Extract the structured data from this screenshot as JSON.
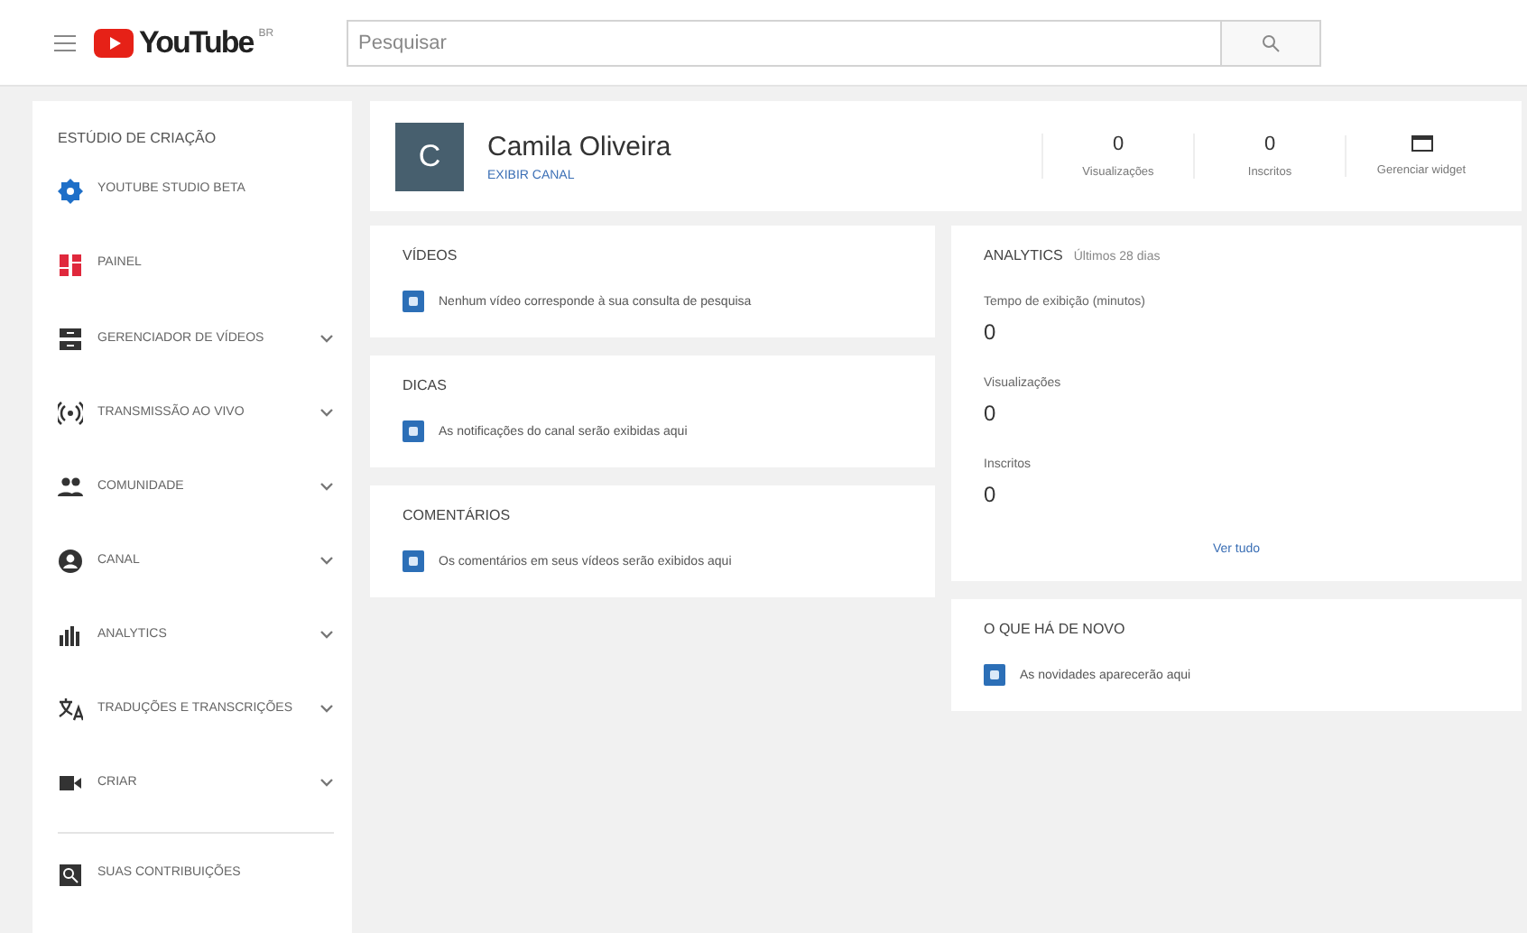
{
  "topbar": {
    "logo": "YouTube",
    "region": "BR",
    "search": {
      "placeholder": "Pesquisar"
    }
  },
  "sidebar": {
    "title": "ESTÚDIO DE CRIAÇÃO",
    "items": [
      {
        "label": "YOUTUBE STUDIO BETA",
        "kind": "gear",
        "color": "#1e6fc8",
        "expandable": false
      },
      {
        "label": "PAINEL",
        "kind": "dashboard",
        "color": "#e0283c",
        "expandable": false
      },
      {
        "label": "GERENCIADOR DE VÍDEOS",
        "kind": "videos",
        "color": "#333333",
        "expandable": true
      },
      {
        "label": "TRANSMISSÃO AO VIVO",
        "kind": "live",
        "color": "#333333",
        "expandable": true
      },
      {
        "label": "COMUNIDADE",
        "kind": "people",
        "color": "#333333",
        "expandable": true
      },
      {
        "label": "CANAL",
        "kind": "account",
        "color": "#333333",
        "expandable": true
      },
      {
        "label": "ANALYTICS",
        "kind": "bars",
        "color": "#333333",
        "expandable": true
      },
      {
        "label": "TRADUÇÕES E TRANSCRIÇÕES",
        "kind": "translate",
        "color": "#333333",
        "expandable": true
      },
      {
        "label": "CRIAR",
        "kind": "camera",
        "color": "#333333",
        "expandable": true
      }
    ],
    "footer": {
      "label": "SUAS CONTRIBUIÇÕES"
    }
  },
  "channel": {
    "initial": "C",
    "name": "Camila Oliveira",
    "link": "EXIBIR CANAL",
    "stats": [
      {
        "value": "0",
        "label": "Visualizações"
      },
      {
        "value": "0",
        "label": "Inscritos"
      }
    ],
    "widget": "Gerenciar widget"
  },
  "cards": [
    {
      "title": "VÍDEOS",
      "message": "Nenhum vídeo corresponde à sua consulta de pesquisa"
    },
    {
      "title": "DICAS",
      "message": "As notificações do canal serão exibidas aqui"
    },
    {
      "title": "COMENTÁRIOS",
      "message": "Os comentários em seus vídeos serão exibidos aqui"
    }
  ],
  "analytics": {
    "title": "ANALYTICS",
    "period": "Últimos 28 dias",
    "metrics": [
      {
        "label": "Tempo de exibição (minutos)",
        "value": "0"
      },
      {
        "label": "Visualizações",
        "value": "0"
      },
      {
        "label": "Inscritos",
        "value": "0"
      }
    ],
    "link": "Ver tudo"
  },
  "news": {
    "title": "O QUE HÁ DE NOVO",
    "message": "As novidades aparecerão aqui"
  }
}
